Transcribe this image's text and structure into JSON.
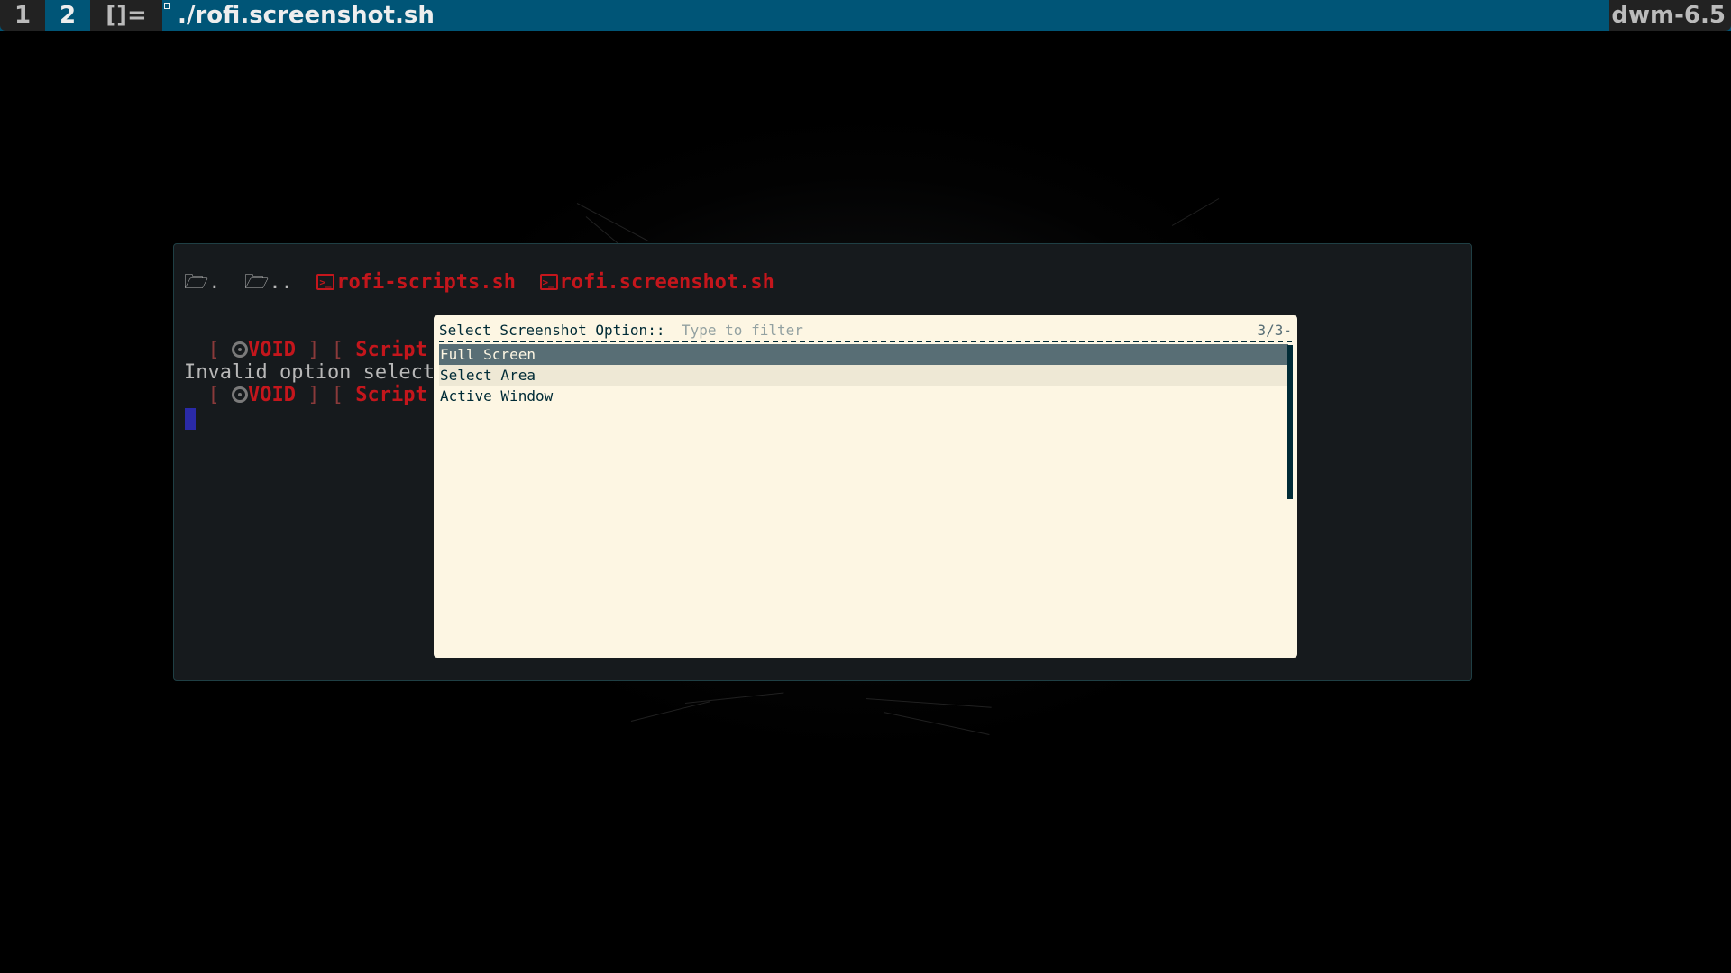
{
  "bar": {
    "tags": [
      "1",
      "2"
    ],
    "layout_symbol": "[]=",
    "window_title": "./rofi.screenshot.sh",
    "status_text": "dwm-6.5"
  },
  "terminal": {
    "listing": {
      "dirs": [
        ".",
        ".."
      ],
      "scripts": [
        "rofi-scripts.sh",
        "rofi.screenshot.sh"
      ]
    },
    "prompt": {
      "open_bracket": "[",
      "distro": "VOID",
      "close_bracket": "]",
      "segment": "Script"
    },
    "error_line": "Invalid option selecte"
  },
  "rofi": {
    "prompt": "Select Screenshot Option::",
    "filter_placeholder": "Type to filter",
    "count": "3/3-",
    "items": [
      "Full Screen",
      "Select Area",
      "Active Window"
    ],
    "selected_index": 0
  },
  "colors": {
    "bar_selected": "#005577",
    "bar_normal": "#222222",
    "terminal_bg": "#161a1d",
    "script_red": "#c4161c",
    "rofi_bg": "#fdf6e3",
    "rofi_selected": "#586e75"
  }
}
